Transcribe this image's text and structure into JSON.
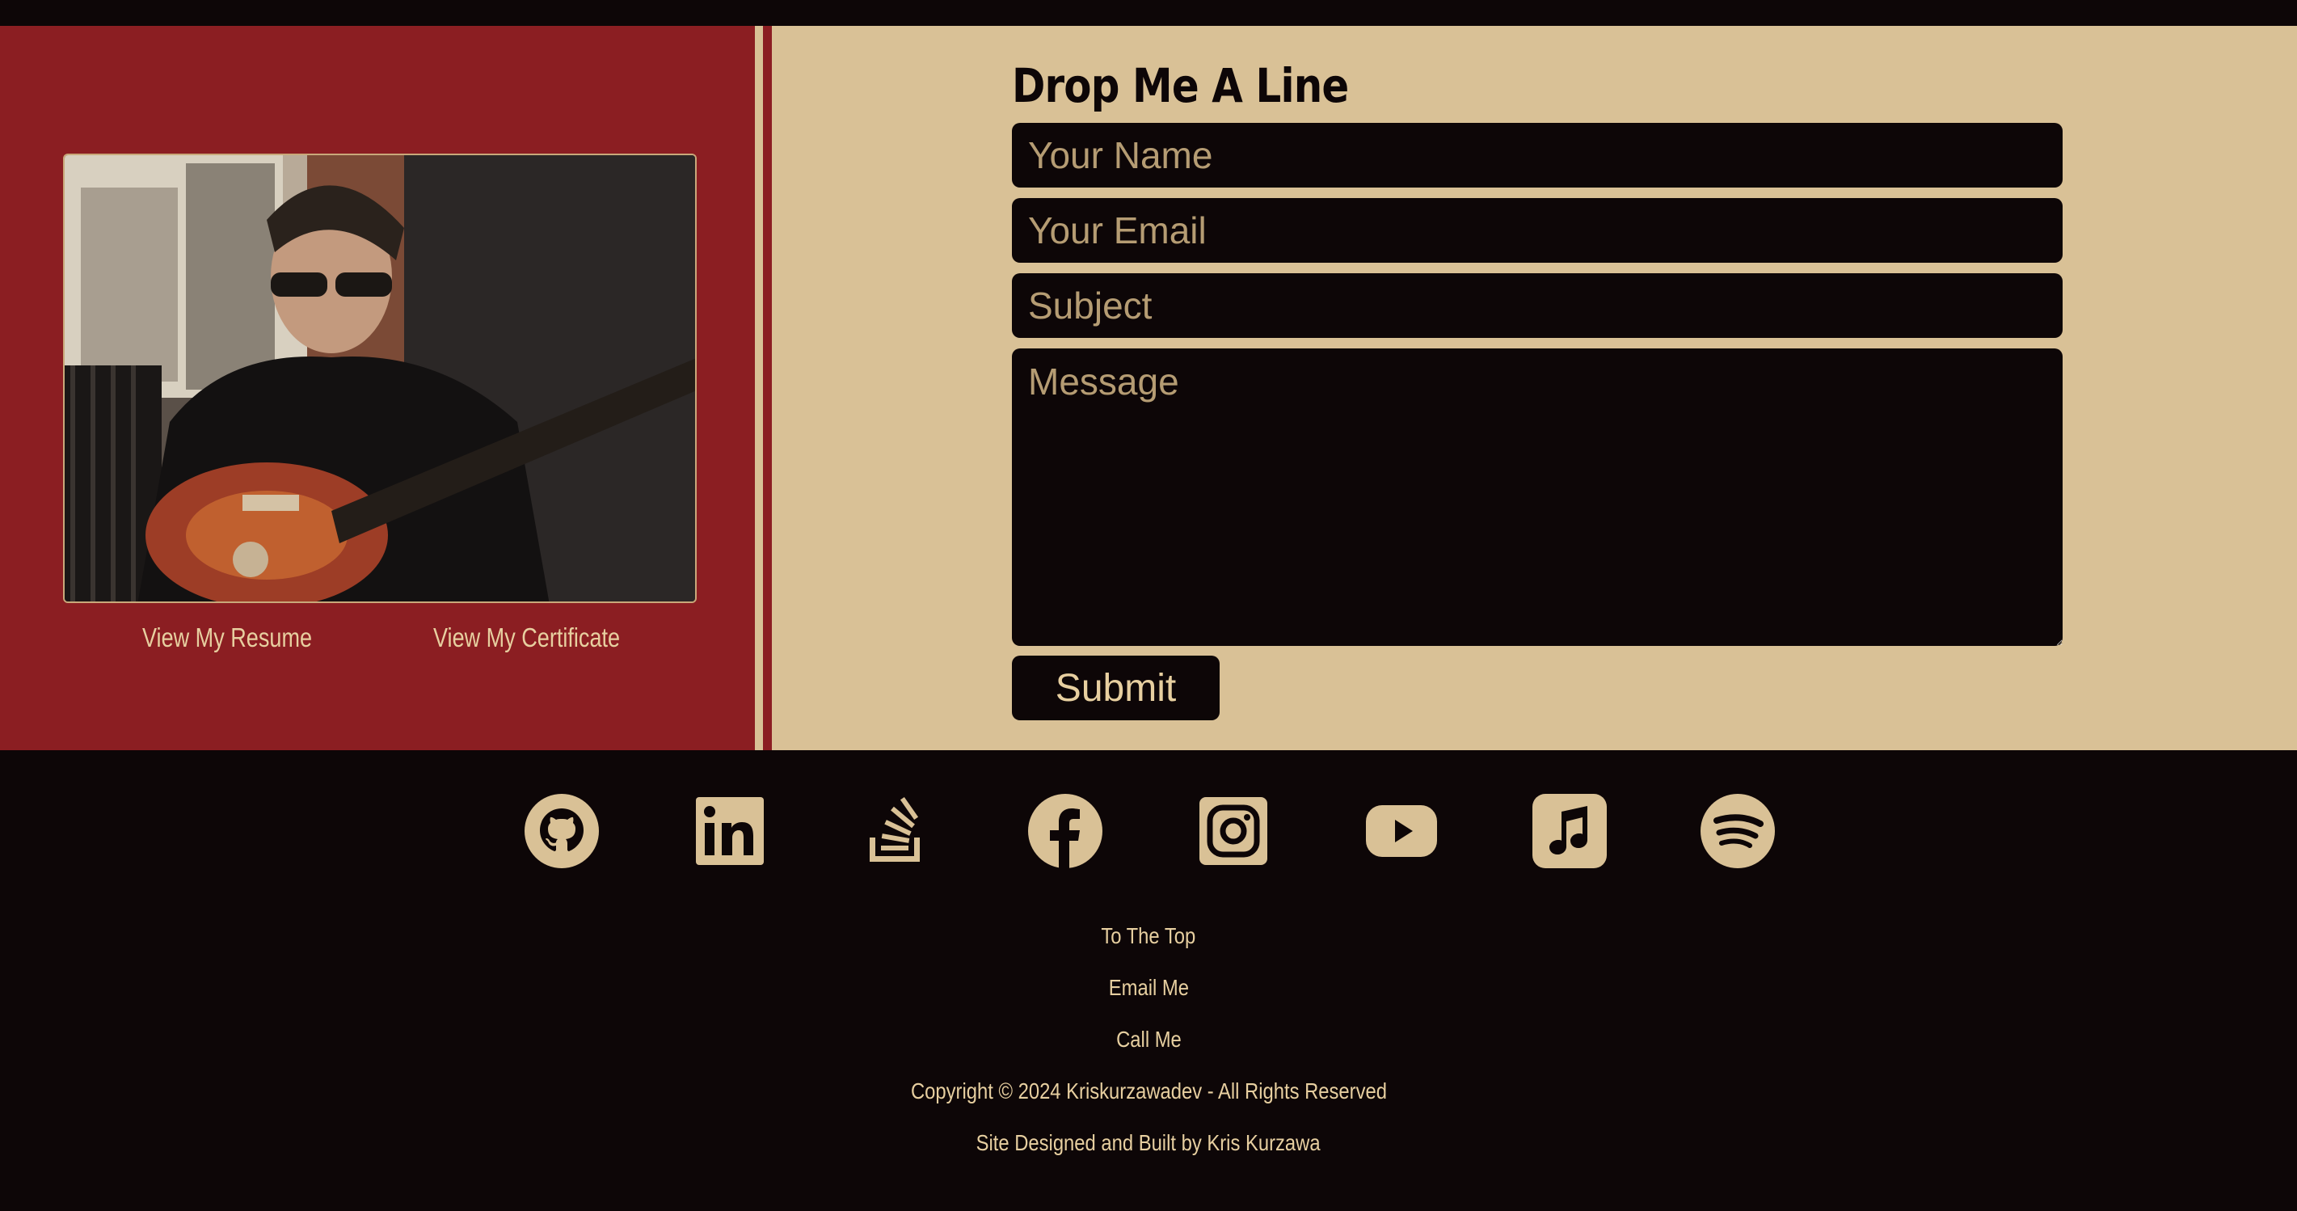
{
  "colors": {
    "accent_red": "#8b1e22",
    "tan": "#d9c196",
    "dark": "#0d0607",
    "link_text": "#e7cfa0"
  },
  "profile": {
    "photo_alt": "Kris Kurzawa playing guitar",
    "resume_label": "View My Resume",
    "certificate_label": "View My Certificate"
  },
  "contact_form": {
    "title": "Drop Me A Line",
    "name_placeholder": "Your Name",
    "email_placeholder": "Your Email",
    "subject_placeholder": "Subject",
    "message_placeholder": "Message",
    "submit_label": "Submit"
  },
  "social": [
    {
      "icon": "github-icon"
    },
    {
      "icon": "linkedin-icon"
    },
    {
      "icon": "stackoverflow-icon"
    },
    {
      "icon": "facebook-icon"
    },
    {
      "icon": "instagram-icon"
    },
    {
      "icon": "youtube-icon"
    },
    {
      "icon": "apple-music-icon"
    },
    {
      "icon": "spotify-icon"
    }
  ],
  "footer": {
    "to_top": "To The Top",
    "email": "Email Me",
    "call": "Call Me",
    "copyright": "Copyright © 2024 Kriskurzawadev - All Rights Reserved",
    "credit": "Site Designed and Built by Kris Kurzawa"
  }
}
